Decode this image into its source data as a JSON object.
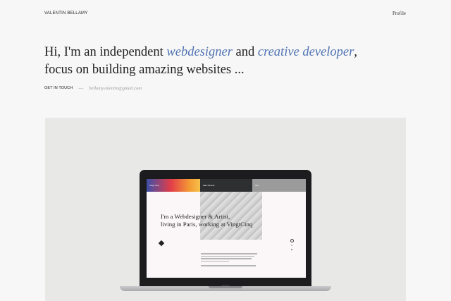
{
  "header": {
    "brand": "VALENTIN BELLAMY",
    "profile_link": "Profile"
  },
  "hero": {
    "part1": "Hi, I'm an independent ",
    "accent1": "webdesigner",
    "part2": " and ",
    "accent2": "creative developer",
    "part3": ",",
    "line2": "focus on building amazing websites ..."
  },
  "contact": {
    "cta": "GET IN TOUCH",
    "dash": "—",
    "email": "bellamyvalentin@gmail.com"
  },
  "colors": {
    "accent": "#4f73b3",
    "background": "#f7f7f7",
    "showcase_bg": "#e8e8e7"
  },
  "showcase": {
    "screen": {
      "tab1": "Vingt Cinq",
      "tab2": "Marc Brandt",
      "tab3": "Info",
      "heading_line1": "I'm a Webdesigner & Artist,",
      "heading_line2": "living in Paris, working at VingtCinq"
    },
    "base_label": "MacBook"
  }
}
